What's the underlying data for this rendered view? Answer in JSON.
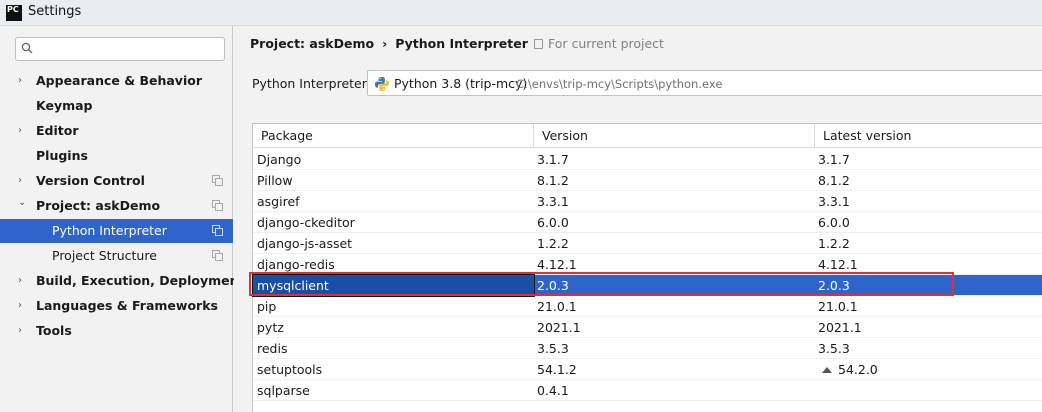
{
  "window": {
    "title": "Settings",
    "logo_text": "PC"
  },
  "search": {
    "placeholder": "",
    "value": ""
  },
  "sidebar": {
    "items": [
      {
        "label": "Appearance & Behavior",
        "arrow": "›",
        "bold": true
      },
      {
        "label": "Keymap",
        "arrow": "",
        "bold": true
      },
      {
        "label": "Editor",
        "arrow": "›",
        "bold": true
      },
      {
        "label": "Plugins",
        "arrow": "",
        "bold": true
      },
      {
        "label": "Version Control",
        "arrow": "›",
        "bold": true
      },
      {
        "label": "Project: askDemo",
        "arrow": "⌄",
        "bold": true
      },
      {
        "label": "Python Interpreter",
        "arrow": "",
        "bold": false
      },
      {
        "label": "Project Structure",
        "arrow": "",
        "bold": false
      },
      {
        "label": "Build, Execution, Deployment",
        "arrow": "›",
        "bold": true
      },
      {
        "label": "Languages & Frameworks",
        "arrow": "›",
        "bold": true
      },
      {
        "label": "Tools",
        "arrow": "›",
        "bold": true
      }
    ]
  },
  "header": {
    "breadcrumb_project": "Project: askDemo",
    "breadcrumb_sep": "›",
    "breadcrumb_page": "Python Interpreter",
    "scope": "For current project"
  },
  "interpreter": {
    "label": "Python Interpreter:",
    "name": "Python 3.8 (trip-mcy)",
    "path": "C:\\envs\\trip-mcy\\Scripts\\python.exe"
  },
  "packages": {
    "columns": [
      "Package",
      "Version",
      "Latest version"
    ],
    "rows": [
      {
        "name": "Django",
        "version": "3.1.7",
        "latest": "3.1.7"
      },
      {
        "name": "Pillow",
        "version": "8.1.2",
        "latest": "8.1.2"
      },
      {
        "name": "asgiref",
        "version": "3.3.1",
        "latest": "3.3.1"
      },
      {
        "name": "django-ckeditor",
        "version": "6.0.0",
        "latest": "6.0.0"
      },
      {
        "name": "django-js-asset",
        "version": "1.2.2",
        "latest": "1.2.2"
      },
      {
        "name": "django-redis",
        "version": "4.12.1",
        "latest": "4.12.1"
      },
      {
        "name": "mysqlclient",
        "version": "2.0.3",
        "latest": "2.0.3"
      },
      {
        "name": "pip",
        "version": "21.0.1",
        "latest": "21.0.1"
      },
      {
        "name": "pytz",
        "version": "2021.1",
        "latest": "2021.1"
      },
      {
        "name": "redis",
        "version": "3.5.3",
        "latest": "3.5.3"
      },
      {
        "name": "setuptools",
        "version": "54.1.2",
        "latest": "54.2.0"
      },
      {
        "name": "sqlparse",
        "version": "0.4.1",
        "latest": ""
      }
    ]
  },
  "colors": {
    "selection": "#2f65ca",
    "highlight_border": "#d9323a"
  }
}
